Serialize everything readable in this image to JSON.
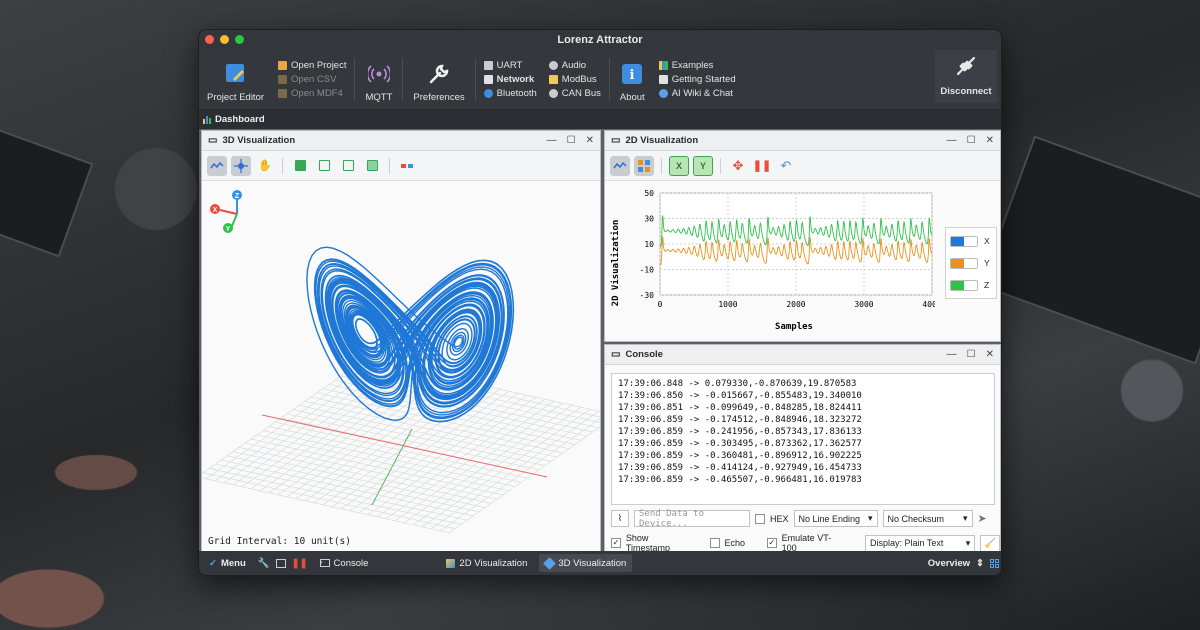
{
  "window": {
    "title": "Lorenz Attractor"
  },
  "toolbar": {
    "project_editor": "Project Editor",
    "project_group": [
      "Open Project",
      "Open CSV",
      "Open MDF4"
    ],
    "mqtt": "MQTT",
    "preferences": "Preferences",
    "io_left": [
      "UART",
      "Network",
      "Bluetooth"
    ],
    "io_right": [
      "Audio",
      "ModBus",
      "CAN Bus"
    ],
    "about": "About",
    "help_group": [
      "Examples",
      "Getting Started",
      "AI Wiki & Chat"
    ],
    "disconnect": "Disconnect"
  },
  "dashboard_tab": "Dashboard",
  "panel3d": {
    "title": "3D Visualization",
    "grid_text": "Grid Interval: 10 unit(s)",
    "axes": {
      "x": "X",
      "y": "Y",
      "z": "Z"
    }
  },
  "panel2d": {
    "title": "2D Visualization",
    "chart_data": {
      "type": "line",
      "xlabel": "Samples",
      "ylabel": "2D Visualization",
      "xlim": [
        0,
        4000
      ],
      "ylim": [
        -30,
        50
      ],
      "xticks": [
        "0",
        "1000",
        "2000",
        "3000",
        "4000"
      ],
      "yticks": [
        "50",
        "30",
        "10",
        "-10",
        "-30"
      ],
      "grid": true,
      "legend_position": "right",
      "series": [
        {
          "name": "X",
          "color": "#2277dd",
          "visible": false
        },
        {
          "name": "Y",
          "color": "#e8921c"
        },
        {
          "name": "Z",
          "color": "#2ec24a"
        }
      ]
    }
  },
  "console": {
    "title": "Console",
    "lines": [
      "17:39:06.848 -> 0.079330,-0.870639,19.870583",
      "17:39:06.850 -> -0.015667,-0.855483,19.340010",
      "17:39:06.851 -> -0.099649,-0.848285,18.824411",
      "17:39:06.859 -> -0.174512,-0.848946,18.323272",
      "17:39:06.859 -> -0.241956,-0.857343,17.836133",
      "17:39:06.859 -> -0.303495,-0.873362,17.362577",
      "17:39:06.859 -> -0.360481,-0.896912,16.902225",
      "17:39:06.859 -> -0.414124,-0.927949,16.454733",
      "17:39:06.859 -> -0.465507,-0.966481,16.019783"
    ],
    "send_placeholder": "Send Data to Device...",
    "hex_label": "HEX",
    "line_ending": "No Line Ending",
    "checksum": "No Checksum",
    "show_timestamp": "Show Timestamp",
    "echo": "Echo",
    "emulate": "Emulate VT-100",
    "display_mode": "Display: Plain Text"
  },
  "statusbar": {
    "menu": "Menu",
    "tabs": [
      "Console",
      "2D Visualization",
      "3D Visualization"
    ],
    "overview": "Overview"
  },
  "colors": {
    "accent": "#2277dd",
    "y_series": "#e8921c",
    "z_series": "#2ec24a",
    "stop": "#e74c3c"
  }
}
